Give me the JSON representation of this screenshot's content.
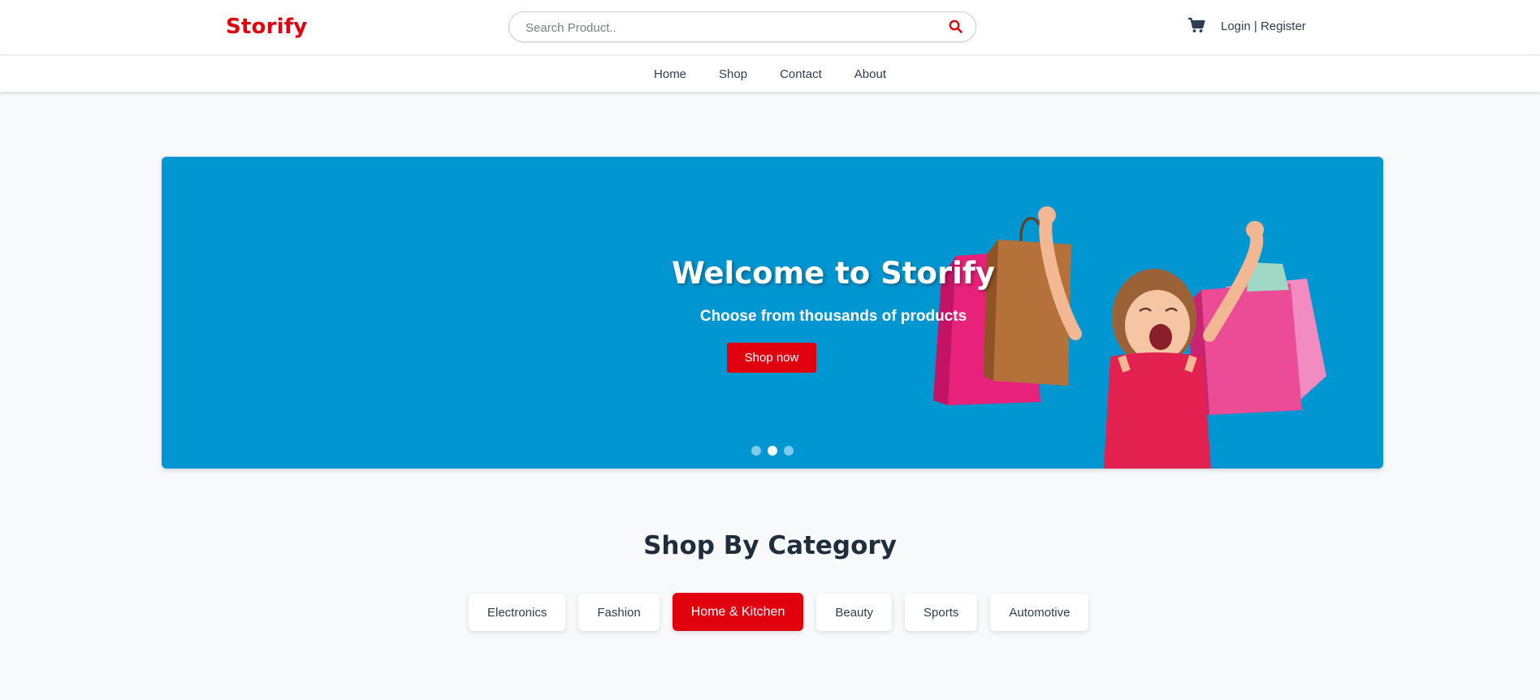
{
  "header": {
    "brand": "Storify",
    "search_placeholder": "Search Product..",
    "search_value": "",
    "login_label": "Login",
    "separator": " | ",
    "register_label": "Register"
  },
  "nav": {
    "items": [
      {
        "label": "Home"
      },
      {
        "label": "Shop"
      },
      {
        "label": "Contact"
      },
      {
        "label": "About"
      }
    ]
  },
  "hero": {
    "title": "Welcome to Storify",
    "subtitle": "Choose from thousands of products",
    "button_label": "Shop now",
    "slide_count": 3,
    "active_slide": 2,
    "background_color": "#0096d1"
  },
  "categories": {
    "title": "Shop By Category",
    "items": [
      {
        "label": "Electronics",
        "active": false
      },
      {
        "label": "Fashion",
        "active": false
      },
      {
        "label": "Home & Kitchen",
        "active": true
      },
      {
        "label": "Beauty",
        "active": false
      },
      {
        "label": "Sports",
        "active": false
      },
      {
        "label": "Automotive",
        "active": false
      }
    ]
  },
  "colors": {
    "brand": "#e0000e",
    "text": "#2c3e50",
    "page_background": "#f8f9fa"
  },
  "icons": [
    "search-icon",
    "cart-icon"
  ]
}
